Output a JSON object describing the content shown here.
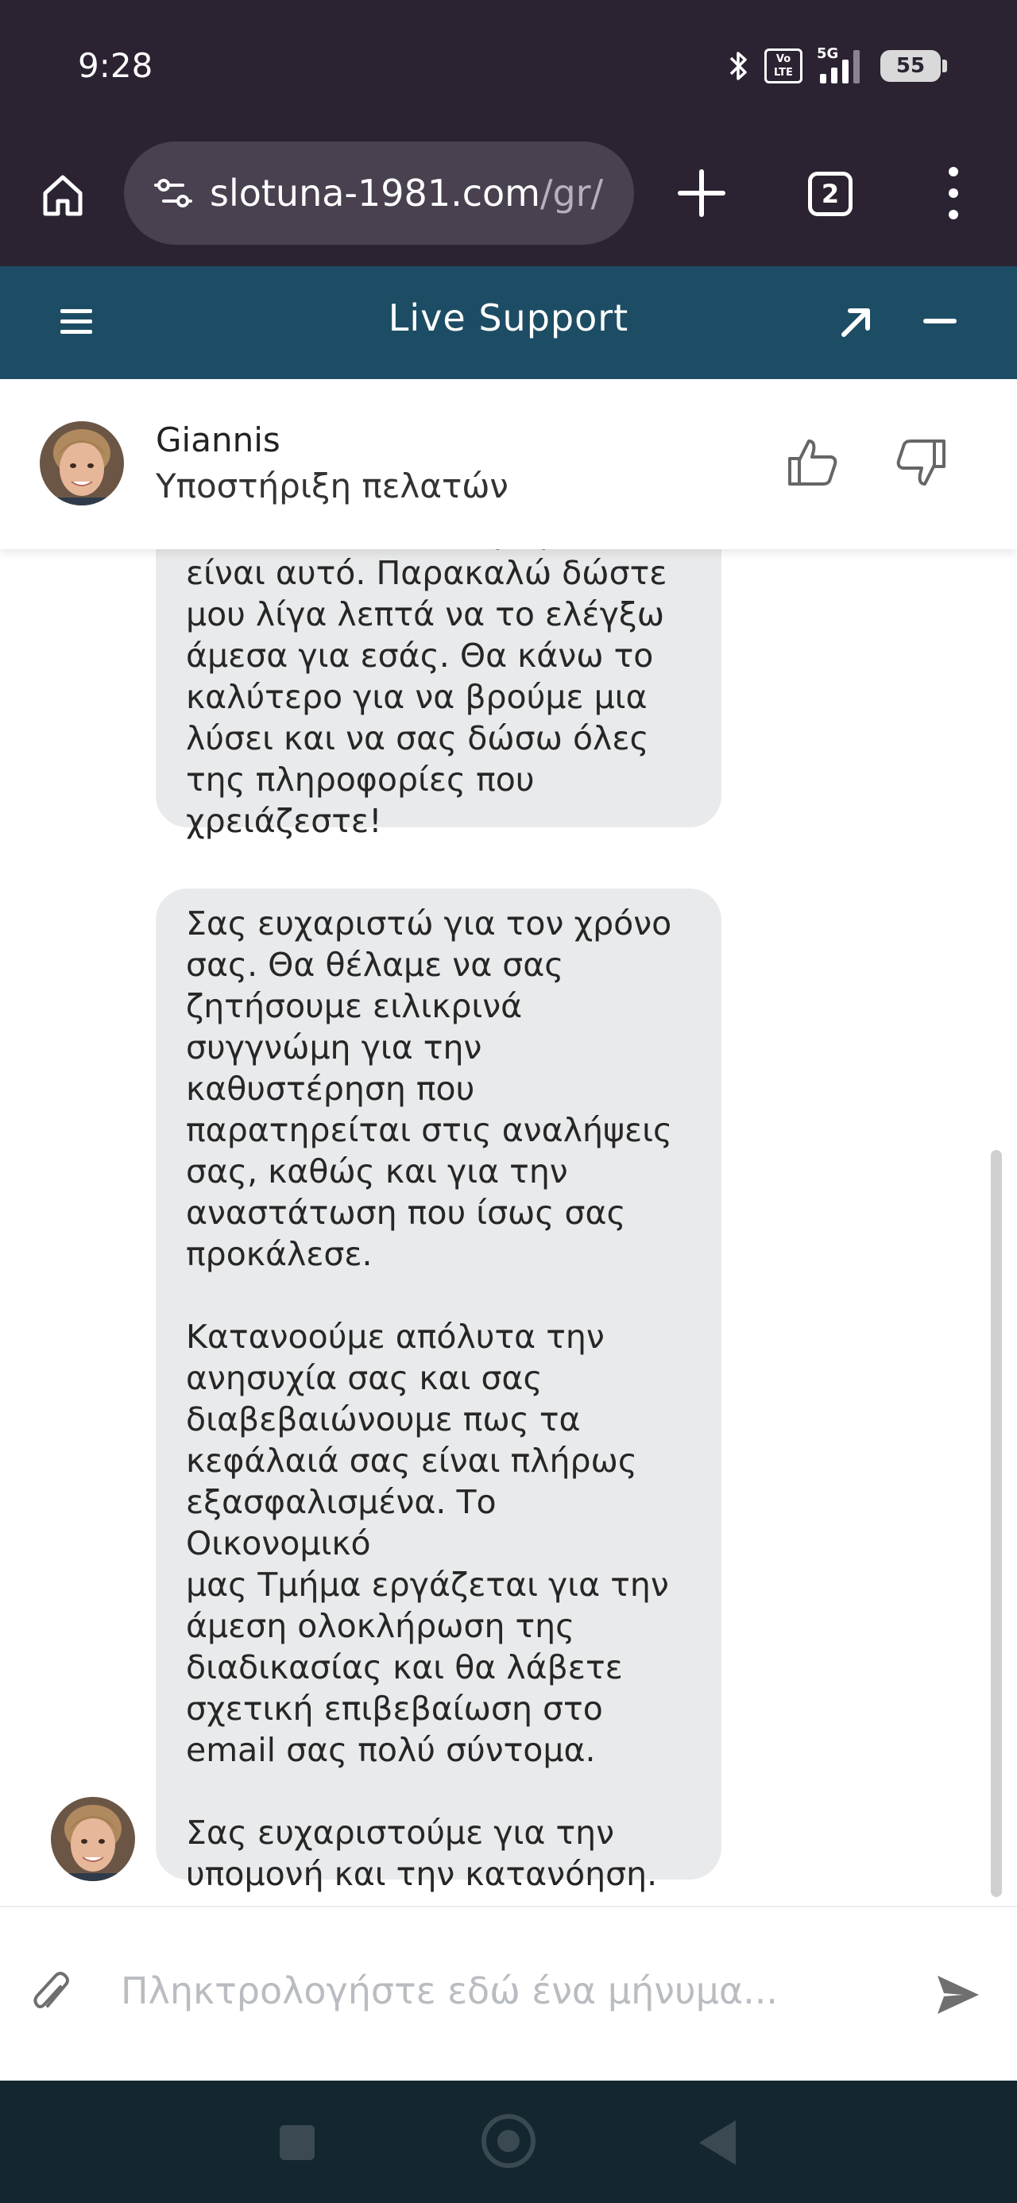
{
  "status_bar": {
    "time": "9:28",
    "volte_label": "Vo\nLTE",
    "network_label": "5G",
    "battery_level": "55",
    "icons": [
      "bluetooth-icon",
      "volte-icon",
      "signal-icon",
      "battery-icon"
    ]
  },
  "browser": {
    "url_host": "slotuna-1981.com",
    "url_path": "/gr/",
    "tab_count": "2",
    "icons": [
      "home-icon",
      "site-settings-icon",
      "new-tab-icon",
      "tabs-icon",
      "more-menu-icon"
    ]
  },
  "chat": {
    "title": "Live Support",
    "icons": [
      "menu-icon",
      "expand-icon",
      "minimize-icon"
    ],
    "header_color": "#1d4d64"
  },
  "agent": {
    "name": "Giannis",
    "role": "Υποστήριξη πελατών",
    "icons": [
      "thumbs-up-icon",
      "thumbs-down-icon"
    ]
  },
  "messages": [
    {
      "sender": "agent",
      "text": "απόλυτα πόσο απογοητευτικό\nείναι αυτό. Παρακαλώ δώστε\nμου λίγα λεπτά να το ελέγξω\nάμεσα για εσάς. Θα κάνω το\nκαλύτερο για να βρούμε μια\nλύσει και να σας δώσω όλες\nτης πληροφορίες που\nχρειάζεστε!"
    },
    {
      "sender": "agent",
      "text": "Σας ευχαριστώ για τον χρόνο\nσας. Θα θέλαμε να σας\nζητήσουμε ειλικρινά\nσυγγνώμη για την\nκαθυστέρηση που\nπαρατηρείται στις αναλήψεις\nσας, καθώς και για την\nαναστάτωση που ίσως σας\nπροκάλεσε.\n\nΚατανοούμε απόλυτα την\nανησυχία σας και σας\nδιαβεβαιώνουμε πως τα\nκεφάλαιά σας είναι πλήρως\nεξασφαλισμένα. Το Οικονομικό\nμας Τμήμα εργάζεται για την\nάμεση ολοκλήρωση της\nδιαδικασίας και θα λάβετε\nσχετική επιβεβαίωση στο\nemail σας πολύ σύντομα.\n\nΣας ευχαριστούμε για την\nυπομονή και την κατανόηση."
    }
  ],
  "composer": {
    "placeholder": "Πληκτρολογήστε εδώ ένα μήνυμα...",
    "value": "",
    "icons": [
      "attachment-icon",
      "send-icon"
    ]
  },
  "navigation": {
    "icons": [
      "recents-icon",
      "home-nav-icon",
      "back-icon"
    ]
  }
}
